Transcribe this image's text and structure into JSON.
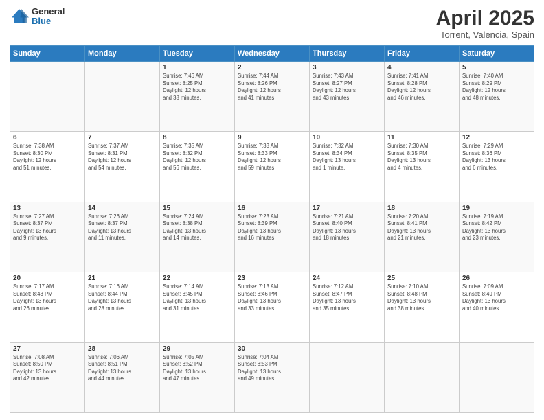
{
  "header": {
    "logo": {
      "general": "General",
      "blue": "Blue"
    },
    "title": "April 2025",
    "subtitle": "Torrent, Valencia, Spain"
  },
  "weekdays": [
    "Sunday",
    "Monday",
    "Tuesday",
    "Wednesday",
    "Thursday",
    "Friday",
    "Saturday"
  ],
  "weeks": [
    [
      {
        "day": "",
        "info": ""
      },
      {
        "day": "",
        "info": ""
      },
      {
        "day": "1",
        "info": "Sunrise: 7:46 AM\nSunset: 8:25 PM\nDaylight: 12 hours\nand 38 minutes."
      },
      {
        "day": "2",
        "info": "Sunrise: 7:44 AM\nSunset: 8:26 PM\nDaylight: 12 hours\nand 41 minutes."
      },
      {
        "day": "3",
        "info": "Sunrise: 7:43 AM\nSunset: 8:27 PM\nDaylight: 12 hours\nand 43 minutes."
      },
      {
        "day": "4",
        "info": "Sunrise: 7:41 AM\nSunset: 8:28 PM\nDaylight: 12 hours\nand 46 minutes."
      },
      {
        "day": "5",
        "info": "Sunrise: 7:40 AM\nSunset: 8:29 PM\nDaylight: 12 hours\nand 48 minutes."
      }
    ],
    [
      {
        "day": "6",
        "info": "Sunrise: 7:38 AM\nSunset: 8:30 PM\nDaylight: 12 hours\nand 51 minutes."
      },
      {
        "day": "7",
        "info": "Sunrise: 7:37 AM\nSunset: 8:31 PM\nDaylight: 12 hours\nand 54 minutes."
      },
      {
        "day": "8",
        "info": "Sunrise: 7:35 AM\nSunset: 8:32 PM\nDaylight: 12 hours\nand 56 minutes."
      },
      {
        "day": "9",
        "info": "Sunrise: 7:33 AM\nSunset: 8:33 PM\nDaylight: 12 hours\nand 59 minutes."
      },
      {
        "day": "10",
        "info": "Sunrise: 7:32 AM\nSunset: 8:34 PM\nDaylight: 13 hours\nand 1 minute."
      },
      {
        "day": "11",
        "info": "Sunrise: 7:30 AM\nSunset: 8:35 PM\nDaylight: 13 hours\nand 4 minutes."
      },
      {
        "day": "12",
        "info": "Sunrise: 7:29 AM\nSunset: 8:36 PM\nDaylight: 13 hours\nand 6 minutes."
      }
    ],
    [
      {
        "day": "13",
        "info": "Sunrise: 7:27 AM\nSunset: 8:37 PM\nDaylight: 13 hours\nand 9 minutes."
      },
      {
        "day": "14",
        "info": "Sunrise: 7:26 AM\nSunset: 8:37 PM\nDaylight: 13 hours\nand 11 minutes."
      },
      {
        "day": "15",
        "info": "Sunrise: 7:24 AM\nSunset: 8:38 PM\nDaylight: 13 hours\nand 14 minutes."
      },
      {
        "day": "16",
        "info": "Sunrise: 7:23 AM\nSunset: 8:39 PM\nDaylight: 13 hours\nand 16 minutes."
      },
      {
        "day": "17",
        "info": "Sunrise: 7:21 AM\nSunset: 8:40 PM\nDaylight: 13 hours\nand 18 minutes."
      },
      {
        "day": "18",
        "info": "Sunrise: 7:20 AM\nSunset: 8:41 PM\nDaylight: 13 hours\nand 21 minutes."
      },
      {
        "day": "19",
        "info": "Sunrise: 7:19 AM\nSunset: 8:42 PM\nDaylight: 13 hours\nand 23 minutes."
      }
    ],
    [
      {
        "day": "20",
        "info": "Sunrise: 7:17 AM\nSunset: 8:43 PM\nDaylight: 13 hours\nand 26 minutes."
      },
      {
        "day": "21",
        "info": "Sunrise: 7:16 AM\nSunset: 8:44 PM\nDaylight: 13 hours\nand 28 minutes."
      },
      {
        "day": "22",
        "info": "Sunrise: 7:14 AM\nSunset: 8:45 PM\nDaylight: 13 hours\nand 31 minutes."
      },
      {
        "day": "23",
        "info": "Sunrise: 7:13 AM\nSunset: 8:46 PM\nDaylight: 13 hours\nand 33 minutes."
      },
      {
        "day": "24",
        "info": "Sunrise: 7:12 AM\nSunset: 8:47 PM\nDaylight: 13 hours\nand 35 minutes."
      },
      {
        "day": "25",
        "info": "Sunrise: 7:10 AM\nSunset: 8:48 PM\nDaylight: 13 hours\nand 38 minutes."
      },
      {
        "day": "26",
        "info": "Sunrise: 7:09 AM\nSunset: 8:49 PM\nDaylight: 13 hours\nand 40 minutes."
      }
    ],
    [
      {
        "day": "27",
        "info": "Sunrise: 7:08 AM\nSunset: 8:50 PM\nDaylight: 13 hours\nand 42 minutes."
      },
      {
        "day": "28",
        "info": "Sunrise: 7:06 AM\nSunset: 8:51 PM\nDaylight: 13 hours\nand 44 minutes."
      },
      {
        "day": "29",
        "info": "Sunrise: 7:05 AM\nSunset: 8:52 PM\nDaylight: 13 hours\nand 47 minutes."
      },
      {
        "day": "30",
        "info": "Sunrise: 7:04 AM\nSunset: 8:53 PM\nDaylight: 13 hours\nand 49 minutes."
      },
      {
        "day": "",
        "info": ""
      },
      {
        "day": "",
        "info": ""
      },
      {
        "day": "",
        "info": ""
      }
    ]
  ]
}
